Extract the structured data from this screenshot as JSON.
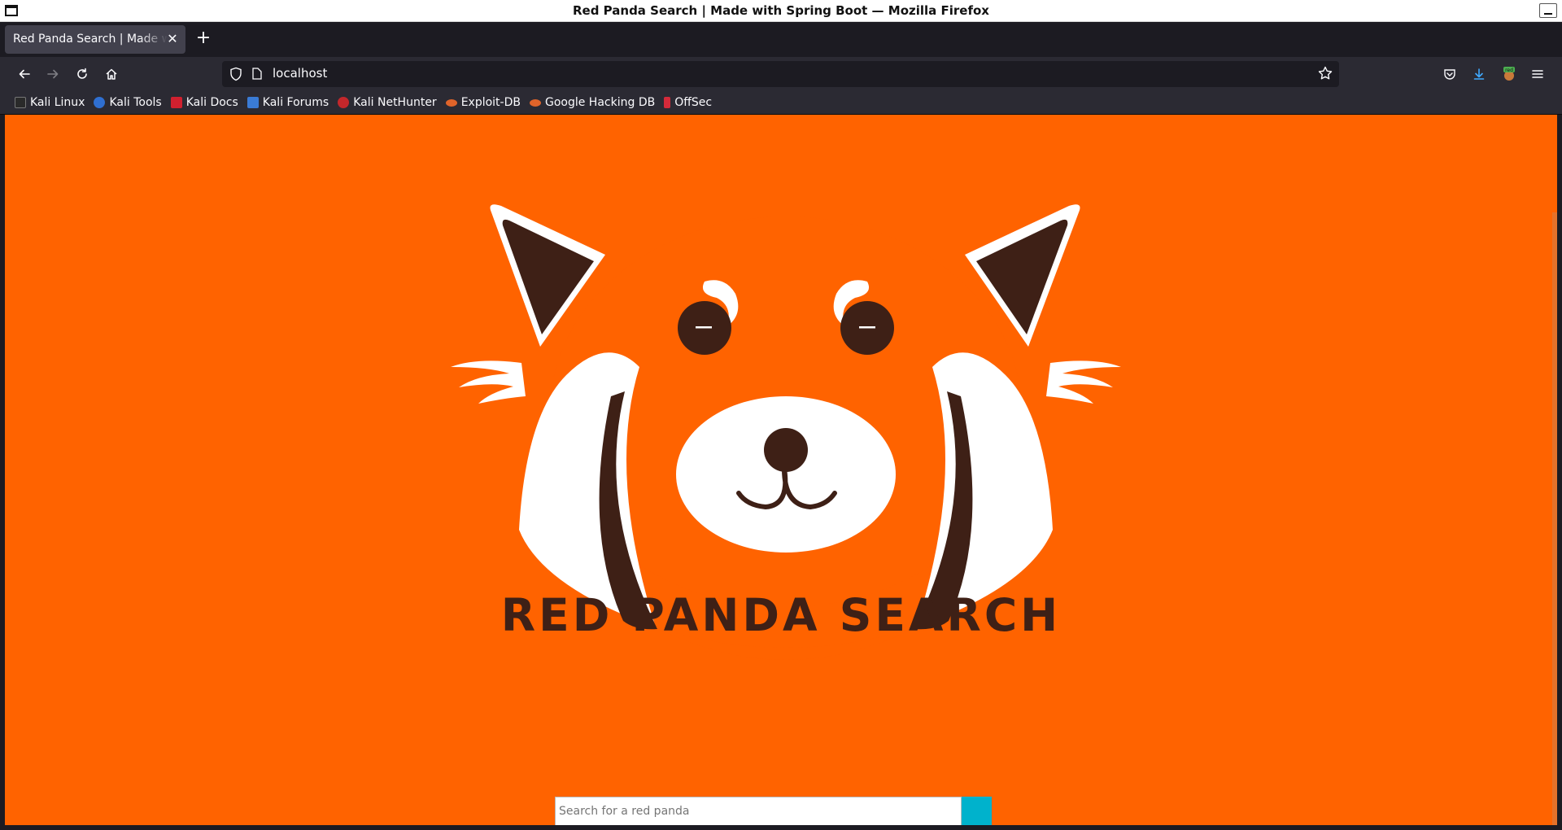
{
  "window": {
    "title": "Red Panda Search | Made with Spring Boot — Mozilla Firefox"
  },
  "tabs": [
    {
      "label": "Red Panda Search | Made with Spring Boot",
      "active": true
    }
  ],
  "navbar": {
    "url": "localhost"
  },
  "bookmarks": [
    {
      "label": "Kali Linux",
      "icon": "kali-dragon-icon",
      "color": "#2a2a2a"
    },
    {
      "label": "Kali Tools",
      "icon": "kali-tools-icon",
      "color": "#2f6fd1"
    },
    {
      "label": "Kali Docs",
      "icon": "kali-docs-icon",
      "color": "#d0202f"
    },
    {
      "label": "Kali Forums",
      "icon": "kali-forums-icon",
      "color": "#3a7bd5"
    },
    {
      "label": "Kali NetHunter",
      "icon": "kali-nethunter-icon",
      "color": "#c3272b"
    },
    {
      "label": "Exploit-DB",
      "icon": "exploit-db-icon",
      "color": "#e0642a"
    },
    {
      "label": "Google Hacking DB",
      "icon": "ghdb-icon",
      "color": "#e0642a"
    },
    {
      "label": "OffSec",
      "icon": "offsec-icon",
      "color": "#d42a3a"
    }
  ],
  "page": {
    "brand_title": "RED PANDA SEARCH",
    "search_placeholder": "Search for a red panda",
    "search_value": "",
    "background_color": "#ff6300",
    "search_button_color": "#00b2cc"
  },
  "colors": {
    "panda_dark": "#3e2016",
    "panda_white": "#ffffff"
  }
}
